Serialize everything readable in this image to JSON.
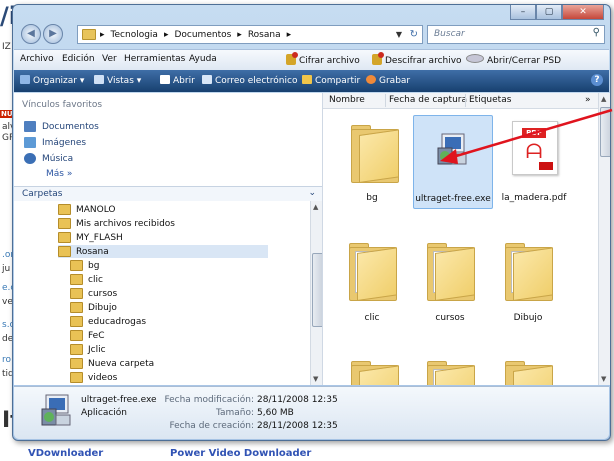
{
  "background_page": {
    "heading_fragment": "/i",
    "left_fragments": [
      "IZ",
      "NU",
      "alv",
      "GR",
      ".or",
      "ju",
      "e.c",
      "ve",
      "s.c",
      "de",
      "ro",
      "tid"
    ],
    "it_fragment": "It",
    "bottom_links": [
      "VDownloader",
      "Power Video Downloader"
    ]
  },
  "window": {
    "caption_buttons": [
      "–",
      "▢",
      "✕"
    ]
  },
  "address": {
    "crumbs": [
      "Tecnologia",
      "Documentos",
      "Rosana"
    ],
    "search_placeholder": "Buscar"
  },
  "menubar": {
    "items": [
      "Archivo",
      "Edición",
      "Ver",
      "Herramientas",
      "Ayuda"
    ],
    "cifrar": "Cifrar archivo",
    "descifrar": "Descifrar archivo",
    "psd": "Abrir/Cerrar PSD"
  },
  "toolbar": {
    "organizar": "Organizar",
    "vistas": "Vistas",
    "abrir": "Abrir",
    "correo": "Correo electrónico",
    "compartir": "Compartir",
    "grabar": "Grabar"
  },
  "nav": {
    "favorites_header": "Vínculos favoritos",
    "favorites": [
      "Documentos",
      "Imágenes",
      "Música"
    ],
    "more": "Más »",
    "folders_header": "Carpetas",
    "tree": [
      "MANOLO",
      "Mis archivos recibidos",
      "MY_FLASH",
      "Rosana",
      "bg",
      "clic",
      "cursos",
      "Dibujo",
      "educadrogas",
      "FeC",
      "Jclic",
      "Nueva carpeta",
      "videos"
    ]
  },
  "columns": [
    "Nombre",
    "Fecha de captura",
    "Etiquetas"
  ],
  "files": [
    "bg",
    "ultraget-free.exe",
    "la_madera.pdf",
    "clic",
    "cursos",
    "Dibujo"
  ],
  "pdf_badge": "PDF",
  "details": {
    "name": "ultraget-free.exe",
    "type": "Aplicación",
    "mod_label": "Fecha modificación:",
    "mod_value": "28/11/2008 12:35",
    "size_label": "Tamaño:",
    "size_value": "5,60 MB",
    "created_label": "Fecha de creación:",
    "created_value": "28/11/2008 12:35"
  },
  "colors": {
    "toolbar": "#1d4a7e",
    "folder": "#e9c870",
    "arrow": "#e0141e",
    "selection": "#cfe3f8"
  }
}
